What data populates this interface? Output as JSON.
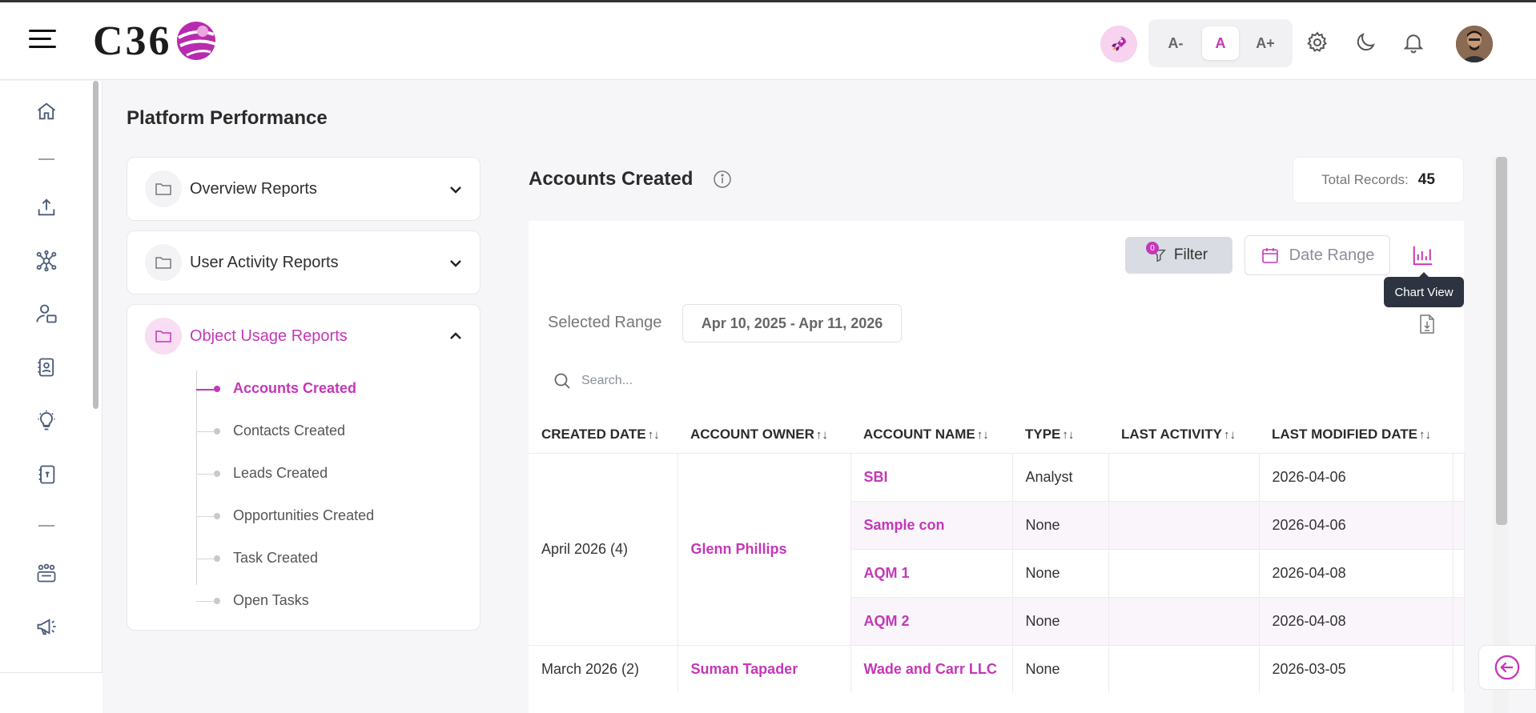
{
  "header": {
    "logo_text": "C36",
    "font_buttons": [
      "A-",
      "A",
      "A+"
    ],
    "active_font": "A"
  },
  "page": {
    "title": "Platform Performance"
  },
  "reports_nav": {
    "groups": [
      {
        "label": "Overview Reports",
        "expanded": false
      },
      {
        "label": "User Activity Reports",
        "expanded": false
      },
      {
        "label": "Object Usage Reports",
        "expanded": true,
        "items": [
          "Accounts Created",
          "Contacts Created",
          "Leads Created",
          "Opportunities Created",
          "Task Created",
          "Open Tasks"
        ],
        "active_item": "Accounts Created"
      }
    ]
  },
  "report": {
    "title": "Accounts Created",
    "total_label": "Total Records:",
    "total_value": "45",
    "filter_label": "Filter",
    "filter_count": "0",
    "date_range_label": "Date Range",
    "chart_tooltip": "Chart View",
    "selected_range_label": "Selected Range",
    "selected_range_value": "Apr 10, 2025 - Apr 11, 2026",
    "search_placeholder": "Search...",
    "columns": [
      "CREATED DATE",
      "ACCOUNT OWNER",
      "ACCOUNT NAME",
      "TYPE",
      "LAST ACTIVITY",
      "LAST MODIFIED DATE"
    ],
    "groups": [
      {
        "created": "April 2026 (4)",
        "owner": "Glenn Phillips",
        "rows": [
          {
            "name": "SBI",
            "type": "Analyst",
            "last_activity": "",
            "modified": "2026-04-06"
          },
          {
            "name": "Sample con",
            "type": "None",
            "last_activity": "",
            "modified": "2026-04-06"
          },
          {
            "name": "AQM 1",
            "type": "None",
            "last_activity": "",
            "modified": "2026-04-08"
          },
          {
            "name": "AQM 2",
            "type": "None",
            "last_activity": "",
            "modified": "2026-04-08"
          }
        ]
      },
      {
        "created": "March 2026 (2)",
        "owner": "Suman Tapader",
        "rows": [
          {
            "name": "Wade and Carr LLC",
            "type": "None",
            "last_activity": "",
            "modified": "2026-03-05"
          }
        ]
      }
    ]
  },
  "colors": {
    "accent": "#c437b8",
    "tooltip_bg": "#2d3340"
  }
}
